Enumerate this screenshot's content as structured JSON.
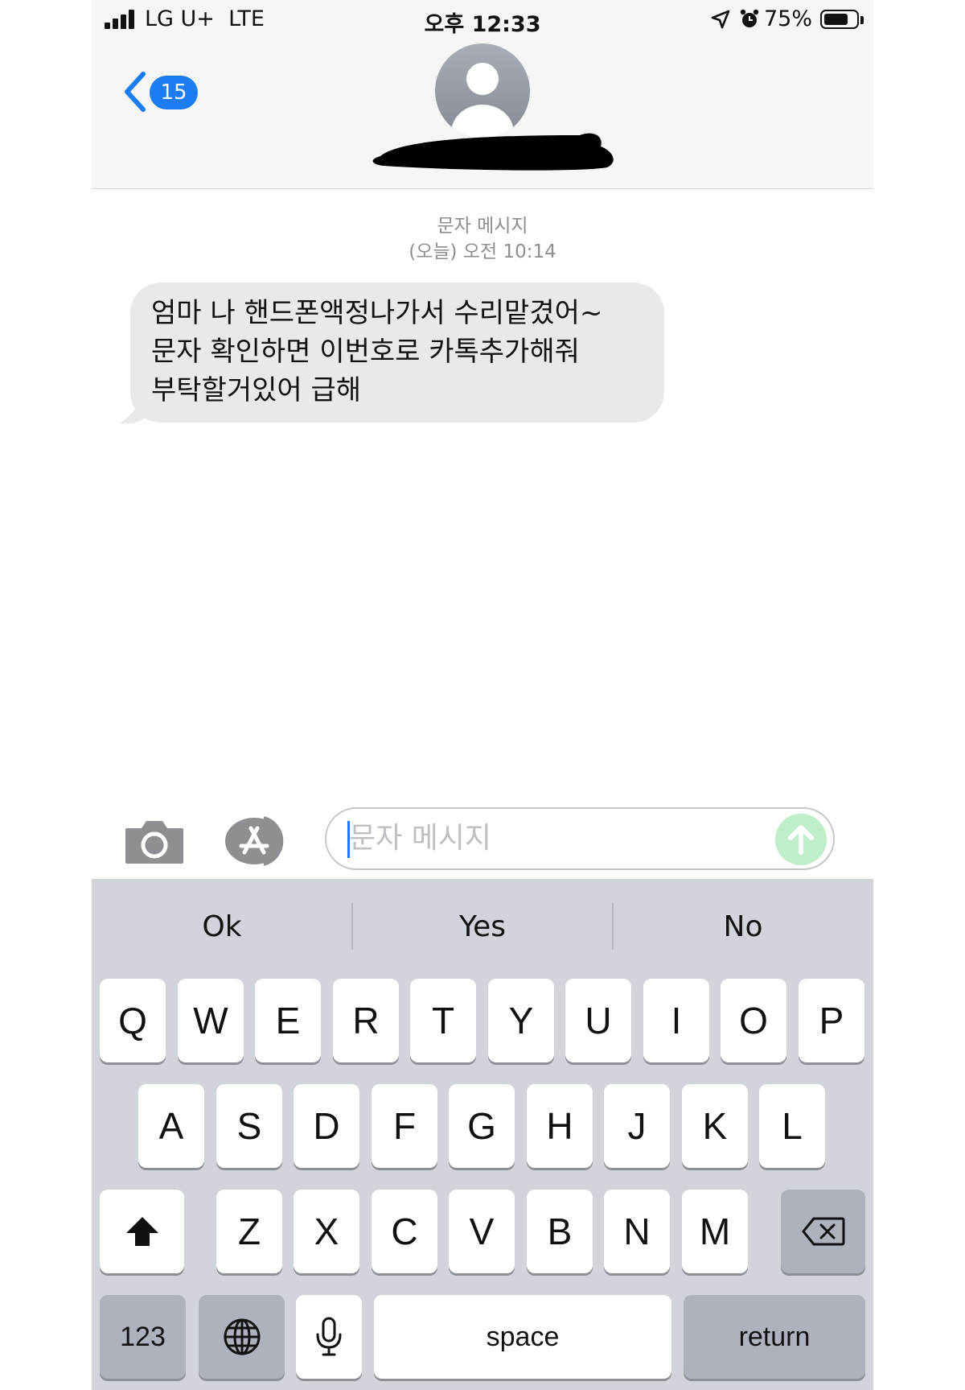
{
  "status_bar": {
    "carrier": "LG U+",
    "network": "LTE",
    "time": "오후 12:33",
    "battery_percent": "75%",
    "battery_level": 0.75
  },
  "header": {
    "back_badge_count": "15"
  },
  "conversation": {
    "message_type": "문자 메시지",
    "timestamp": "(오늘) 오전 10:14",
    "messages": [
      {
        "sender": "them",
        "text": "엄마 나 핸드폰액정나가서 수리맡겼어~문자 확인하면 이번호로 카톡추가해줘 부탁할거있어 급해"
      }
    ]
  },
  "input": {
    "placeholder": "문자 메시지"
  },
  "keyboard": {
    "suggestions": [
      "Ok",
      "Yes",
      "No"
    ],
    "row1": [
      "Q",
      "W",
      "E",
      "R",
      "T",
      "Y",
      "U",
      "I",
      "O",
      "P"
    ],
    "row2": [
      "A",
      "S",
      "D",
      "F",
      "G",
      "H",
      "J",
      "K",
      "L"
    ],
    "row3": [
      "Z",
      "X",
      "C",
      "V",
      "B",
      "N",
      "M"
    ],
    "numbers_key": "123",
    "space_key": "space",
    "return_key": "return"
  },
  "colors": {
    "accent": "#1b7cf5",
    "bubble_gray": "#e9e9eb",
    "send_green": "#bfeecb"
  }
}
